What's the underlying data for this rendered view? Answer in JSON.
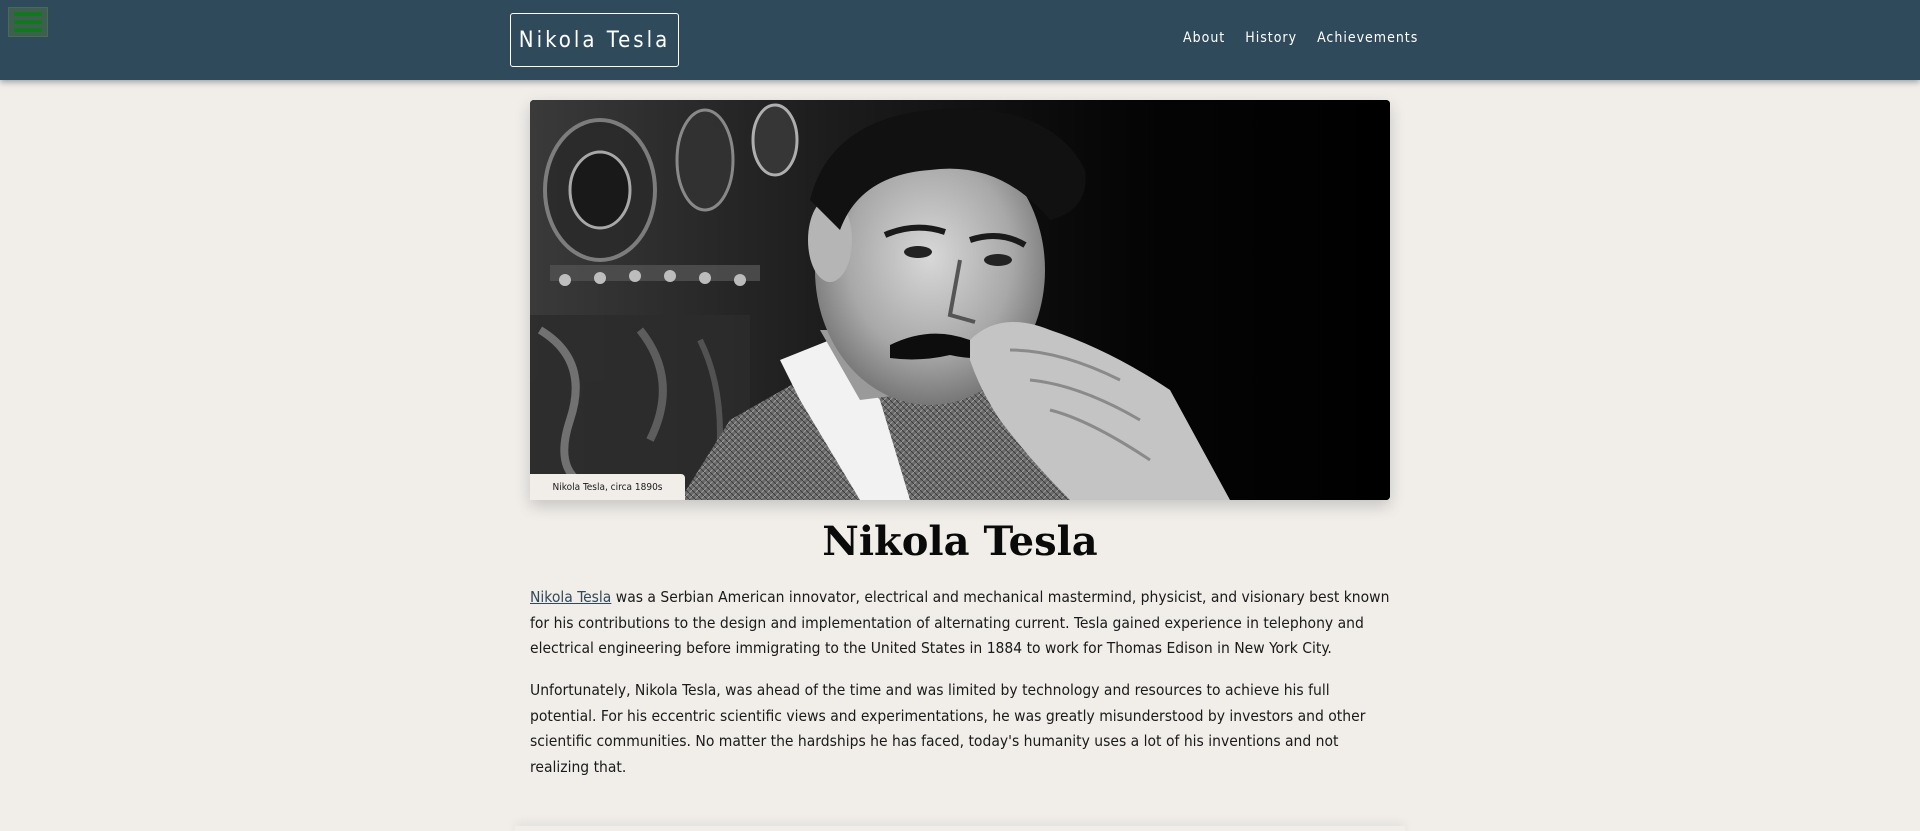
{
  "nav": {
    "menu_icon": "hamburger-menu-icon",
    "brand": "Nikola Tesla",
    "links": [
      "About",
      "History",
      "Achievements"
    ]
  },
  "hero": {
    "image_alt": "Black and white portrait of Nikola Tesla",
    "caption": "Nikola Tesla, circa 1890s"
  },
  "content": {
    "title": "Nikola Tesla",
    "paragraph1_link": "Nikola Tesla",
    "paragraph1_rest": " was a Serbian American innovator, electrical and mechanical mastermind, physicist, and visionary best known for his contributions to the design and implementation of alternating current. Tesla gained experience in telephony and electrical engineering before immigrating to the United States in 1884 to work for Thomas Edison in New York City.",
    "paragraph2": "Unfortunately, Nikola Tesla, was ahead of the time and was limited by technology and resources to achieve his full potential. For his eccentric scientific views and experimentations, he was greatly misunderstood by investors and other scientific communities. No matter the hardships he has faced, today's humanity uses a lot of his inventions and not realizing that."
  },
  "colors": {
    "navbar": "#2f4a5b",
    "background": "#f1eeea",
    "menu_icon": "#0f7a1b",
    "link": "#2f4a5b"
  }
}
